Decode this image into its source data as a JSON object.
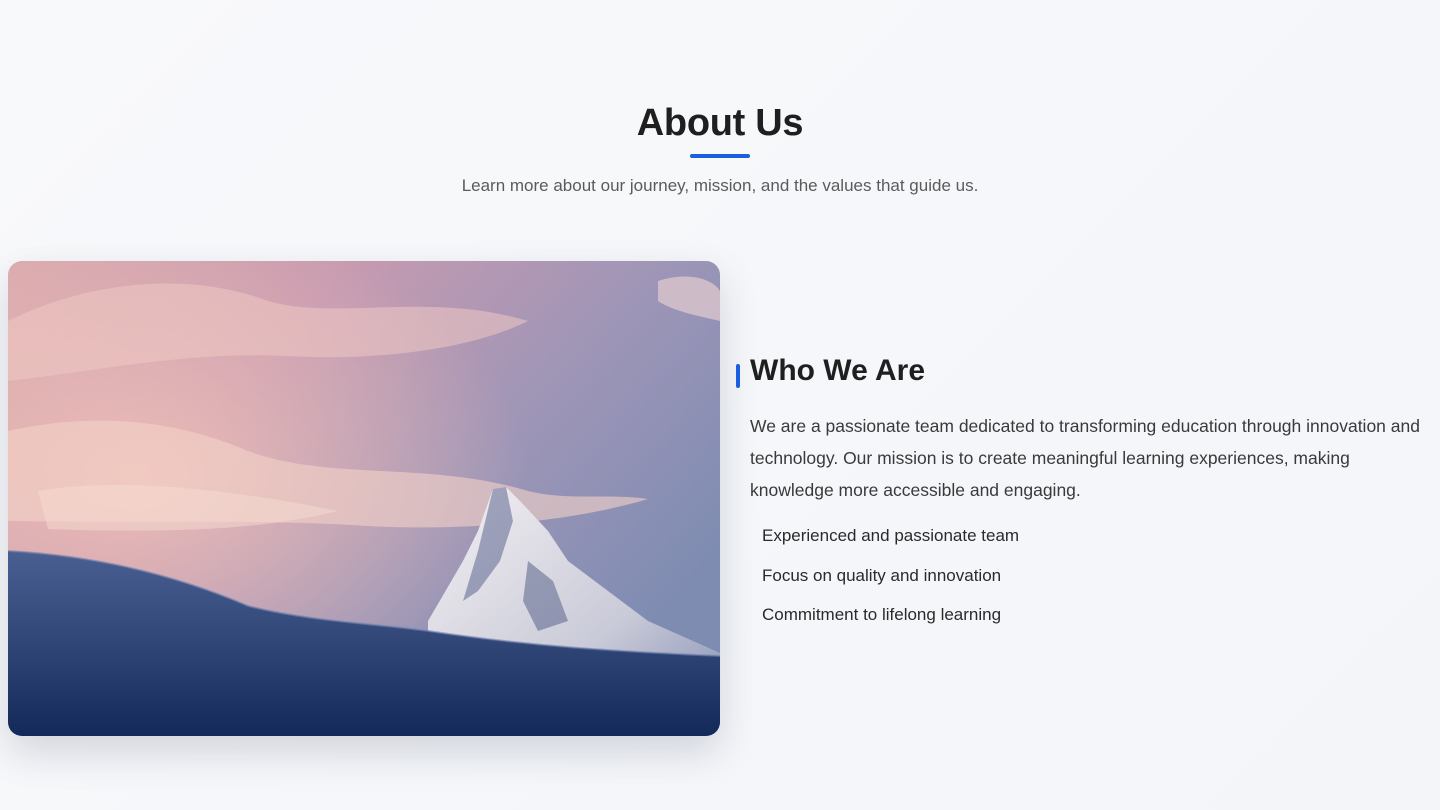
{
  "colors": {
    "accent": "#1a5fe0",
    "title": "#1f1f1f",
    "subtitle": "#5b5b5b"
  },
  "header": {
    "title": "About Us",
    "subtitle": "Learn more about our journey, mission, and the values that guide us."
  },
  "image": {
    "subject": "snow-mountain-peak-at-sunset"
  },
  "about": {
    "heading": "Who We Are",
    "paragraph": "We are a passionate team dedicated to transforming education through innovation and technology. Our mission is to create meaningful learning experiences, making knowledge more accessible and engaging.",
    "features": [
      "Experienced and passionate team",
      "Focus on quality and innovation",
      "Commitment to lifelong learning"
    ]
  }
}
